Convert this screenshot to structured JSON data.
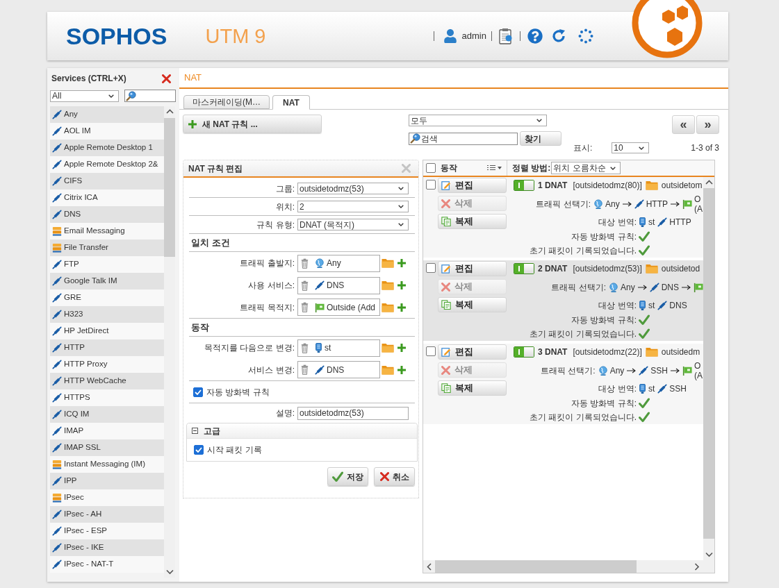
{
  "header": {
    "logo": "SOPHOS",
    "product": "UTM 9",
    "user": "admin"
  },
  "sidebar": {
    "title": "Services (CTRL+X)",
    "filter": "All",
    "items": [
      {
        "label": "Any",
        "kind": "service"
      },
      {
        "label": "AOL IM",
        "kind": "service"
      },
      {
        "label": "Apple Remote Desktop 1",
        "kind": "service"
      },
      {
        "label": "Apple Remote Desktop 2&",
        "kind": "service"
      },
      {
        "label": "CIFS",
        "kind": "service"
      },
      {
        "label": "Citrix ICA",
        "kind": "service"
      },
      {
        "label": "DNS",
        "kind": "service"
      },
      {
        "label": "Email Messaging",
        "kind": "group"
      },
      {
        "label": "File Transfer",
        "kind": "group"
      },
      {
        "label": "FTP",
        "kind": "service"
      },
      {
        "label": "Google Talk IM",
        "kind": "service"
      },
      {
        "label": "GRE",
        "kind": "service"
      },
      {
        "label": "H323",
        "kind": "service"
      },
      {
        "label": "HP JetDirect",
        "kind": "service"
      },
      {
        "label": "HTTP",
        "kind": "service"
      },
      {
        "label": "HTTP Proxy",
        "kind": "service"
      },
      {
        "label": "HTTP WebCache",
        "kind": "service"
      },
      {
        "label": "HTTPS",
        "kind": "service"
      },
      {
        "label": "ICQ IM",
        "kind": "service"
      },
      {
        "label": "IMAP",
        "kind": "service"
      },
      {
        "label": "IMAP SSL",
        "kind": "service"
      },
      {
        "label": "Instant Messaging (IM)",
        "kind": "group"
      },
      {
        "label": "IPP",
        "kind": "service"
      },
      {
        "label": "IPsec",
        "kind": "group"
      },
      {
        "label": "IPsec - AH",
        "kind": "service"
      },
      {
        "label": "IPsec - ESP",
        "kind": "service"
      },
      {
        "label": "IPsec - IKE",
        "kind": "service"
      },
      {
        "label": "IPsec - NAT-T",
        "kind": "service"
      }
    ]
  },
  "breadcrumb": "NAT",
  "tabs": [
    {
      "label": "마스커레이딩(M…",
      "selected": false
    },
    {
      "label": "NAT",
      "selected": true
    }
  ],
  "toolbar": {
    "new_rule": "새 NAT 규칙 ...",
    "filter": "모두",
    "search": "검색",
    "find": "찾기",
    "prev": "«",
    "next": "»",
    "show_label": "표시:",
    "page_size": "10",
    "range": "1-3 of 3"
  },
  "edit_panel": {
    "title": "NAT 규칙 편집",
    "rows": [
      {
        "kind": "select",
        "label": "그룹:",
        "value": "outsidetodmz(53)"
      },
      {
        "kind": "select",
        "label": "위치:",
        "value": "2"
      },
      {
        "kind": "select",
        "label": "규칙 유형:",
        "value": "DNAT (목적지)"
      },
      {
        "kind": "section",
        "label": "일치 조건"
      },
      {
        "kind": "object",
        "label": "트래픽 출발지:",
        "object": {
          "kind": "any",
          "name": "Any"
        }
      },
      {
        "kind": "object",
        "label": "사용 서비스:",
        "object": {
          "kind": "service",
          "name": "DNS"
        }
      },
      {
        "kind": "object",
        "label": "트래픽 목적지:",
        "object": {
          "kind": "network",
          "name": "Outside (Add"
        }
      },
      {
        "kind": "section",
        "label": "동작"
      },
      {
        "kind": "object",
        "label": "목적지를 다음으로 변경:",
        "object": {
          "kind": "host",
          "name": "st"
        }
      },
      {
        "kind": "object",
        "label": "서비스 변경:",
        "object": {
          "kind": "service",
          "name": "DNS"
        }
      },
      {
        "kind": "checkbox",
        "label": "자동 방화벽 규칙",
        "checked": true
      },
      {
        "kind": "text",
        "label": "설명:",
        "value": "outsidetodmz(53)"
      }
    ],
    "advanced": {
      "title": "고급",
      "expanded": true,
      "options": [
        {
          "label": "시작 패킷 기록",
          "checked": true
        }
      ]
    },
    "buttons": [
      {
        "label": "저장",
        "kind": "save"
      },
      {
        "label": "취소",
        "kind": "cancel"
      }
    ]
  },
  "rule_list": {
    "all_checked": false,
    "actions_label": "동작",
    "sort_label": "정렬 방법:",
    "sort": "위치 오름차순",
    "rules": [
      {
        "checked": false,
        "selected": false,
        "enabled": true,
        "title": "1 DNAT",
        "group": "[outsidetodmz(80)]",
        "name": "outsidetom",
        "actions": [
          {
            "label": "편집",
            "kind": "edit",
            "disabled": false
          },
          {
            "label": "삭제",
            "kind": "delete",
            "disabled": true
          },
          {
            "label": "복제",
            "kind": "copy",
            "disabled": false
          }
        ],
        "selector_label": "트래픽 선택기:",
        "selector": [
          {
            "kind": "any",
            "name": "Any"
          },
          {
            "kind": "service",
            "name": "HTTP"
          },
          {
            "kind": "network",
            "name": "O (A"
          }
        ],
        "translation_label": "대상 번역:",
        "translation": [
          {
            "kind": "host",
            "name": "st"
          },
          {
            "kind": "service",
            "name": "HTTP"
          }
        ],
        "firewall_label": "자동 방화벽 규칙:",
        "auto_firewall": true,
        "log_label": "초기 패킷이 기록되었습니다.",
        "log_initial": true
      },
      {
        "checked": false,
        "selected": true,
        "enabled": true,
        "title": "2 DNAT",
        "group": "[outsidetodmz(53)]",
        "name": "outsidetod",
        "actions": [
          {
            "label": "편집",
            "kind": "edit",
            "disabled": false
          },
          {
            "label": "삭제",
            "kind": "delete",
            "disabled": true
          },
          {
            "label": "복제",
            "kind": "copy",
            "disabled": false
          }
        ],
        "selector_label": "트래픽 선택기:",
        "selector": [
          {
            "kind": "any",
            "name": "Any"
          },
          {
            "kind": "service",
            "name": "DNS"
          },
          {
            "kind": "network"
          }
        ],
        "translation_label": "대상 번역:",
        "translation": [
          {
            "kind": "host",
            "name": "st"
          },
          {
            "kind": "service",
            "name": "DNS"
          }
        ],
        "firewall_label": "자동 방화벽 규칙:",
        "auto_firewall": true,
        "log_label": "초기 패킷이 기록되었습니다.",
        "log_initial": true
      },
      {
        "checked": false,
        "selected": false,
        "enabled": true,
        "title": "3 DNAT",
        "group": "[outsidetodmz(22)]",
        "name": "outsidedm",
        "actions": [
          {
            "label": "편집",
            "kind": "edit",
            "disabled": false
          },
          {
            "label": "삭제",
            "kind": "delete",
            "disabled": true
          },
          {
            "label": "복제",
            "kind": "copy",
            "disabled": false
          }
        ],
        "selector_label": "트래픽 선택기:",
        "selector": [
          {
            "kind": "any",
            "name": "Any"
          },
          {
            "kind": "service",
            "name": "SSH"
          },
          {
            "kind": "network",
            "name": "O (A"
          }
        ],
        "translation_label": "대상 번역:",
        "translation": [
          {
            "kind": "host",
            "name": "st"
          },
          {
            "kind": "service",
            "name": "SSH"
          }
        ],
        "firewall_label": "자동 방화벽 규칙:",
        "auto_firewall": true,
        "log_label": "초기 패킷이 기록되었습니다.",
        "log_initial": true
      }
    ]
  }
}
